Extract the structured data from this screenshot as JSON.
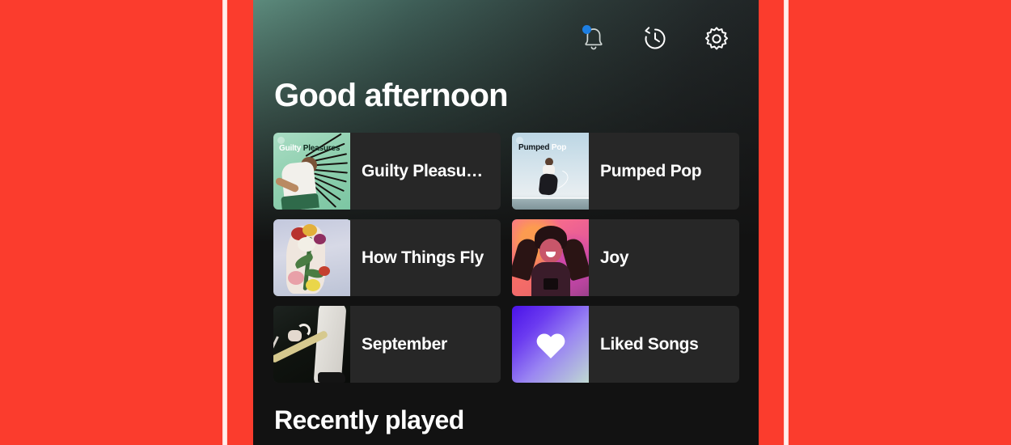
{
  "theme": {
    "backdrop_color": "#fb3c2d",
    "stripe_color": "#fff6f4",
    "screen_bg": "#121212",
    "card_bg": "#272727",
    "accent_text": "#ffffff",
    "notification_dot": "#1d7fe3",
    "liked_gradient_from": "#4a12e8",
    "liked_gradient_to": "#bfd8d2"
  },
  "topbar": {
    "icons": [
      {
        "name": "notifications-bell-icon",
        "label": "Notifications",
        "has_badge": true
      },
      {
        "name": "listening-history-icon",
        "label": "Recently played history"
      },
      {
        "name": "settings-gear-icon",
        "label": "Settings"
      }
    ]
  },
  "header": {
    "greeting": "Good afternoon"
  },
  "shortcuts": {
    "items": [
      {
        "title": "Guilty Pleasures",
        "art_label_a": "Guilty",
        "art_label_b": "Pleasures",
        "art": "guilty"
      },
      {
        "title": "Pumped Pop",
        "art_label_a": "Pumped",
        "art_label_b": "Pop",
        "art": "pumped"
      },
      {
        "title": "How Things Fly",
        "art": "fly"
      },
      {
        "title": "Joy",
        "art": "joy"
      },
      {
        "title": "September",
        "art": "sept"
      },
      {
        "title": "Liked Songs",
        "art": "liked"
      }
    ]
  },
  "sections": {
    "recently_played_heading": "Recently played"
  }
}
